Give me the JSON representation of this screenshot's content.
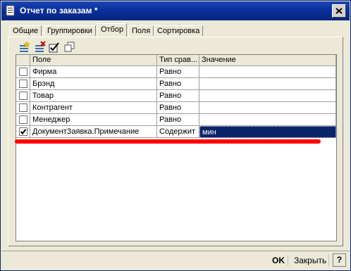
{
  "window": {
    "title": "Отчет по заказам *"
  },
  "tabs": [
    {
      "label": "Общие"
    },
    {
      "label": "Группировки"
    },
    {
      "label": "Отбор"
    },
    {
      "label": "Поля"
    },
    {
      "label": "Сортировка"
    }
  ],
  "active_tab": "Отбор",
  "toolbar": {
    "icons": [
      "add-filter-icon",
      "delete-filter-icon",
      "check-all-icon",
      "copy-icon"
    ]
  },
  "grid": {
    "columns": [
      {
        "label": ""
      },
      {
        "label": "Поле"
      },
      {
        "label": "Тип срав..."
      },
      {
        "label": "Значение"
      }
    ],
    "rows": [
      {
        "checked": false,
        "field": "Фирма",
        "comparison": "Равно",
        "value": ""
      },
      {
        "checked": false,
        "field": "Брэнд",
        "comparison": "Равно",
        "value": ""
      },
      {
        "checked": false,
        "field": "Товар",
        "comparison": "Равно",
        "value": ""
      },
      {
        "checked": false,
        "field": "Контрагент",
        "comparison": "Равно",
        "value": ""
      },
      {
        "checked": false,
        "field": "Менеджер",
        "comparison": "Равно",
        "value": ""
      },
      {
        "checked": true,
        "field": "ДокументЗаявка.Примечание",
        "comparison": "Содержит",
        "value": "мин"
      }
    ]
  },
  "annotation_color": "#ff0000",
  "buttons": {
    "ok": "OK",
    "close": "Закрыть",
    "help": "?"
  }
}
